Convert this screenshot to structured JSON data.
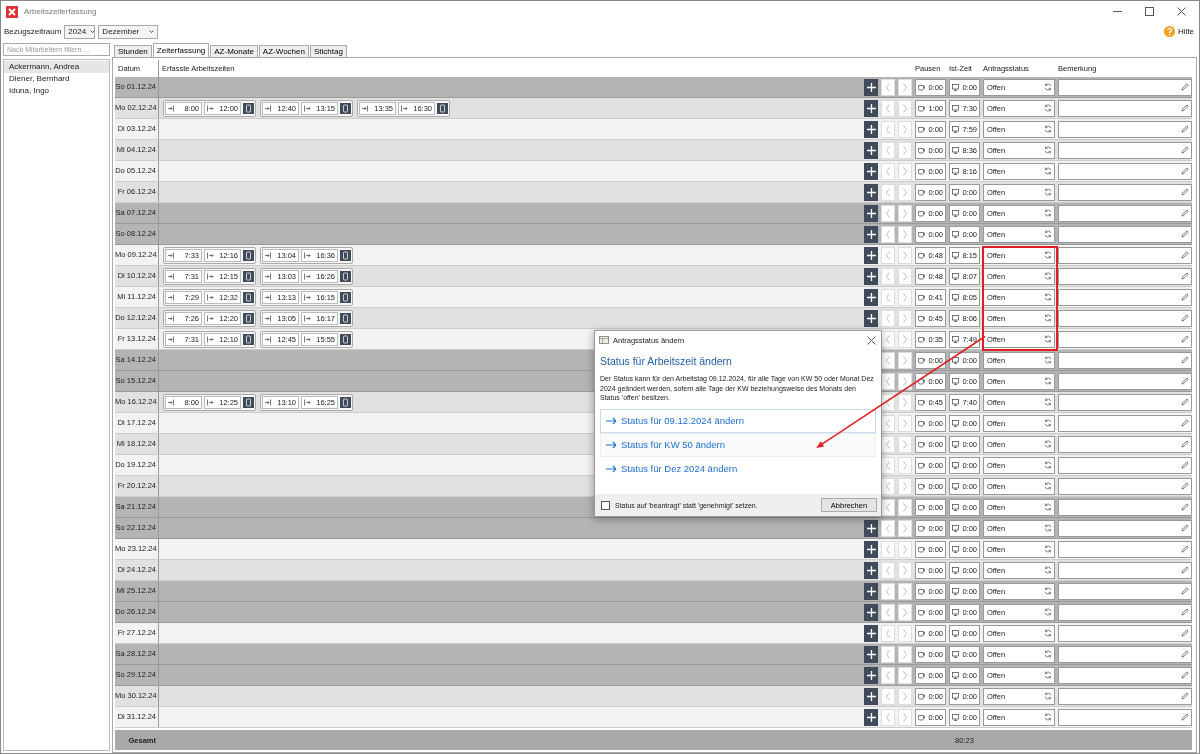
{
  "window": {
    "title": "Arbeitszeiterfassung"
  },
  "toolbar": {
    "period_label": "Bezugszeitraum",
    "year": "2024",
    "month": "Dezember",
    "help": "Hilfe"
  },
  "sidebar": {
    "search": {
      "placeholder": "Nach Mitarbeitern filtern ..."
    },
    "items": [
      {
        "label": "Ackermann, Andrea",
        "selected": true
      },
      {
        "label": "Diener, Bernhard",
        "selected": false
      },
      {
        "label": "Iduna, Ingo",
        "selected": false
      }
    ]
  },
  "tabs": [
    {
      "label": "Stunden",
      "selected": false
    },
    {
      "label": "Zeiterfassung",
      "selected": true
    },
    {
      "label": "AZ-Monate",
      "selected": false
    },
    {
      "label": "AZ-Wochen",
      "selected": false
    },
    {
      "label": "Stichtag",
      "selected": false
    }
  ],
  "table": {
    "columns": {
      "date": "Datum",
      "entries": "Erfasste Arbeitszeiten",
      "pause": "Pausen",
      "actual": "Ist-Zeit",
      "status": "Antragsstatus",
      "remark": "Bemerkung"
    },
    "row_nav_disabled": true,
    "rows": [
      {
        "date": "So 01.12.24",
        "kind": "dayoff",
        "pause": "0:00",
        "actual": "0:00",
        "status": "Offen",
        "highlighted": false
      },
      {
        "date": "Mo 02.12.24",
        "kind": "workday",
        "entries": [
          {
            "in": "8:00",
            "out": "12:00"
          },
          {
            "in": "12:40",
            "out": "13:15"
          },
          {
            "in": "13:35",
            "out": "16:30"
          }
        ],
        "pause": "1:00",
        "actual": "7:30",
        "status": "Offen",
        "highlighted": false
      },
      {
        "date": "Di 03.12.24",
        "kind": "workday",
        "pause": "0:00",
        "actual": "7:59",
        "status": "Offen",
        "highlighted": false
      },
      {
        "date": "Mi 04.12.24",
        "kind": "workday",
        "pause": "0:00",
        "actual": "8:36",
        "status": "Offen",
        "highlighted": false
      },
      {
        "date": "Do 05.12.24",
        "kind": "workday",
        "pause": "0:00",
        "actual": "8:16",
        "status": "Offen",
        "highlighted": false
      },
      {
        "date": "Fr 06.12.24",
        "kind": "workday",
        "pause": "0:00",
        "actual": "0:00",
        "status": "Offen",
        "highlighted": false
      },
      {
        "date": "Sa 07.12.24",
        "kind": "dayoff",
        "pause": "0:00",
        "actual": "0:00",
        "status": "Offen",
        "highlighted": false
      },
      {
        "date": "So 08.12.24",
        "kind": "dayoff",
        "pause": "0:00",
        "actual": "0:00",
        "status": "Offen",
        "highlighted": false
      },
      {
        "date": "Mo 09.12.24",
        "kind": "workday",
        "entries": [
          {
            "in": "7:33",
            "out": "12:16"
          },
          {
            "in": "13:04",
            "out": "16:36"
          }
        ],
        "pause": "0:48",
        "actual": "8:15",
        "status": "Offen",
        "highlighted": true
      },
      {
        "date": "Di 10.12.24",
        "kind": "workday",
        "entries": [
          {
            "in": "7:31",
            "out": "12:15"
          },
          {
            "in": "13:03",
            "out": "16:26"
          }
        ],
        "pause": "0:48",
        "actual": "8:07",
        "status": "Offen",
        "highlighted": true
      },
      {
        "date": "Mi 11.12.24",
        "kind": "workday",
        "entries": [
          {
            "in": "7:29",
            "out": "12:32"
          },
          {
            "in": "13:13",
            "out": "16:15"
          }
        ],
        "pause": "0:41",
        "actual": "8:05",
        "status": "Offen",
        "highlighted": true
      },
      {
        "date": "Do 12.12.24",
        "kind": "workday",
        "entries": [
          {
            "in": "7:26",
            "out": "12:20"
          },
          {
            "in": "13:05",
            "out": "16:17"
          }
        ],
        "pause": "0:45",
        "actual": "8:06",
        "status": "Offen",
        "highlighted": true
      },
      {
        "date": "Fr 13.12.24",
        "kind": "workday",
        "entries": [
          {
            "in": "7:31",
            "out": "12:10"
          },
          {
            "in": "12:45",
            "out": "15:55"
          }
        ],
        "pause": "0:35",
        "actual": "7:49",
        "status": "Offen",
        "highlighted": true
      },
      {
        "date": "Sa 14.12.24",
        "kind": "dayoff",
        "pause": "0:00",
        "actual": "0:00",
        "status": "Offen",
        "highlighted": false
      },
      {
        "date": "So 15.12.24",
        "kind": "dayoff",
        "pause": "0:00",
        "actual": "0:00",
        "status": "Offen",
        "highlighted": false
      },
      {
        "date": "Mo 16.12.24",
        "kind": "workday",
        "entries": [
          {
            "in": "8:00",
            "out": "12:25"
          },
          {
            "in": "13:10",
            "out": "16:25"
          }
        ],
        "pause": "0:45",
        "actual": "7:40",
        "status": "Offen",
        "highlighted": false
      },
      {
        "date": "Di 17.12.24",
        "kind": "workday",
        "pause": "0:00",
        "actual": "0:00",
        "status": "Offen",
        "highlighted": false
      },
      {
        "date": "Mi 18.12.24",
        "kind": "workday",
        "pause": "0:00",
        "actual": "0:00",
        "status": "Offen",
        "highlighted": false
      },
      {
        "date": "Do 19.12.24",
        "kind": "workday",
        "pause": "0:00",
        "actual": "0:00",
        "status": "Offen",
        "highlighted": false
      },
      {
        "date": "Fr 20.12.24",
        "kind": "workday",
        "pause": "0:00",
        "actual": "0:00",
        "status": "Offen",
        "highlighted": false
      },
      {
        "date": "Sa 21.12.24",
        "kind": "dayoff",
        "pause": "0:00",
        "actual": "0:00",
        "status": "Offen",
        "highlighted": false
      },
      {
        "date": "So 22.12.24",
        "kind": "dayoff",
        "pause": "0:00",
        "actual": "0:00",
        "status": "Offen",
        "highlighted": false
      },
      {
        "date": "Mo 23.12.24",
        "kind": "workday",
        "pause": "0:00",
        "actual": "0:00",
        "status": "Offen",
        "highlighted": false
      },
      {
        "date": "Di 24.12.24",
        "kind": "workday",
        "pause": "0:00",
        "actual": "0:00",
        "status": "Offen",
        "highlighted": false
      },
      {
        "date": "Mi 25.12.24",
        "kind": "dayoff",
        "pause": "0:00",
        "actual": "0:00",
        "status": "Offen",
        "highlighted": false
      },
      {
        "date": "Do 26.12.24",
        "kind": "dayoff",
        "pause": "0:00",
        "actual": "0:00",
        "status": "Offen",
        "highlighted": false
      },
      {
        "date": "Fr 27.12.24",
        "kind": "workday",
        "pause": "0:00",
        "actual": "0:00",
        "status": "Offen",
        "highlighted": false
      },
      {
        "date": "Sa 28.12.24",
        "kind": "dayoff",
        "pause": "0:00",
        "actual": "0:00",
        "status": "Offen",
        "highlighted": false
      },
      {
        "date": "So 29.12.24",
        "kind": "dayoff",
        "pause": "0:00",
        "actual": "0:00",
        "status": "Offen",
        "highlighted": false
      },
      {
        "date": "Mo 30.12.24",
        "kind": "workday",
        "pause": "0:00",
        "actual": "0:00",
        "status": "Offen",
        "highlighted": false
      },
      {
        "date": "Di 31.12.24",
        "kind": "workday",
        "pause": "0:00",
        "actual": "0:00",
        "status": "Offen",
        "highlighted": false
      }
    ],
    "total": {
      "label": "Gesamt",
      "actual": "80:23"
    }
  },
  "dialog": {
    "title": "Antragsstatus ändern",
    "heading": "Status für Arbeitszeit ändern",
    "text": "Der Status kann für den Arbeitstag 09.12.2024, für alle Tage von KW 50 oder Monat Dez 2024 geändert werden, sofern alle Tage der KW beziehungsweise des Monats den Status 'offen' besitzen.",
    "options": [
      {
        "label": "Status für 09.12.2024 ändern",
        "selected": true
      },
      {
        "label": "Status für KW 50 ändern",
        "selected": false
      },
      {
        "label": "Status für Dez 2024 ändern",
        "selected": false
      }
    ],
    "checkbox": {
      "label": "Status auf 'beantragt' statt 'genehmigt' setzen.",
      "checked": false
    },
    "cancel": "Abbrechen"
  }
}
